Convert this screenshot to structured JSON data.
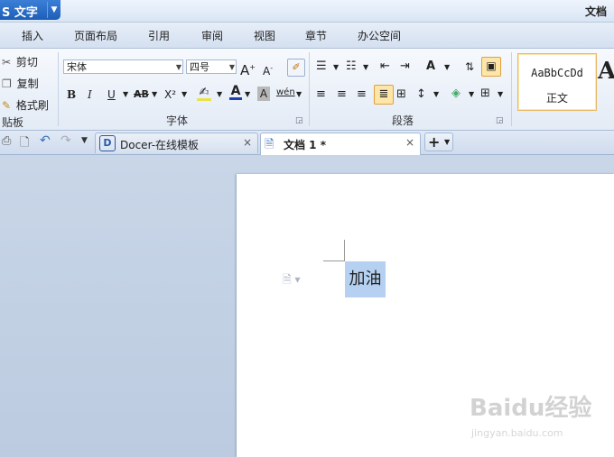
{
  "app": {
    "menu_button": "S 文字",
    "document_title": "文档"
  },
  "menu": {
    "tabs": [
      "插入",
      "页面布局",
      "引用",
      "审阅",
      "视图",
      "章节",
      "办公空间"
    ]
  },
  "clipboard": {
    "cut": "剪切",
    "copy": "复制",
    "format_painter": "格式刷",
    "group_label": "贴板"
  },
  "font": {
    "name": "宋体",
    "size": "四号",
    "group_label": "字体",
    "bold": "B",
    "italic": "I",
    "underline": "U",
    "strike": "AB",
    "superscript": "X²",
    "grow": "A",
    "shrink": "A",
    "color_a": "A",
    "shade_a": "A",
    "phonetic": "wén"
  },
  "paragraph": {
    "group_label": "段落"
  },
  "styles": {
    "sample": "AaBbCcDd",
    "name": "正文",
    "next_sample": "A"
  },
  "doc_tabs": [
    {
      "label": "Docer-在线模板",
      "close": "×"
    },
    {
      "label": "文档 1 *",
      "close": "×"
    }
  ],
  "new_tab": "+",
  "document": {
    "selected_text": "加油"
  },
  "watermark": {
    "brand": "Baidu经验",
    "url": "jingyan.baidu.com"
  },
  "colors": {
    "accent": "#1d5fb8",
    "selection": "#b5d0f1",
    "workspace": "#c9d6e8"
  }
}
